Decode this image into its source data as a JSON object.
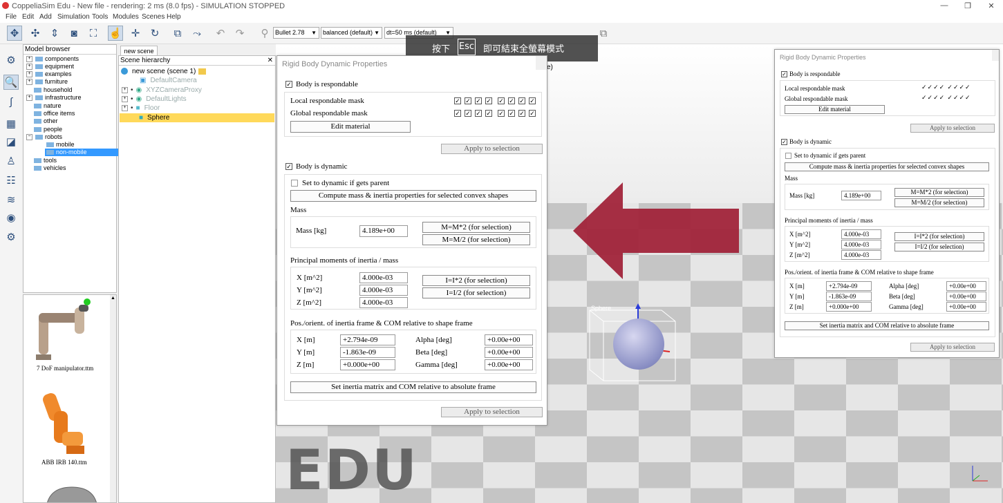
{
  "window": {
    "title": "CoppeliaSim Edu - New file - rendering: 2 ms (8.0 fps) - SIMULATION STOPPED"
  },
  "menu": [
    "File",
    "Edit",
    "Add",
    "Simulation",
    "Tools",
    "Modules",
    "Scenes",
    "Help"
  ],
  "toolbar": {
    "engine": "Bullet 2.78",
    "mode": "balanced (default)",
    "dt": "dt=50 ms (default)"
  },
  "model_browser": {
    "header": "Model browser",
    "items": [
      "components",
      "equipment",
      "examples",
      "furniture",
      "household",
      "infrastructure",
      "nature",
      "office items",
      "other",
      "people",
      "robots",
      "mobile",
      "non-mobile",
      "tools",
      "vehicles"
    ],
    "thumbnails": [
      "7 DoF manipulator.ttm",
      "ABB IRB 140.ttm"
    ]
  },
  "scene": {
    "tab": "new scene",
    "header": "Scene hierarchy",
    "root": "new scene (scene 1)",
    "objects": [
      "DefaultCamera",
      "XYZCameraProxy",
      "DefaultLights",
      "Floor",
      "Sphere"
    ]
  },
  "viewport": {
    "watermark": "EDU",
    "sphere_label": "Sphere",
    "partial_text": "e)"
  },
  "esc_banner": {
    "before": "按下",
    "key": "Esc",
    "after": "即可結束全螢幕模式"
  },
  "dialog": {
    "title": "Rigid Body Dynamic Properties",
    "body_respondable": "Body is respondable",
    "local_mask": "Local respondable mask",
    "global_mask": "Global respondable mask",
    "edit_material": "Edit material",
    "apply": "Apply to selection",
    "body_dynamic": "Body is dynamic",
    "set_dynamic_parent": "Set to dynamic if gets parent",
    "compute_mass": "Compute mass & inertia properties for selected convex shapes",
    "mass_section": "Mass",
    "mass_label": "Mass [kg]",
    "mass_value": "4.189e+00",
    "mass_x2": "M=M*2  (for selection)",
    "mass_div2": "M=M/2  (for selection)",
    "inertia_section": "Principal moments of inertia / mass",
    "ix_label": "X [m^2]",
    "iy_label": "Y [m^2]",
    "iz_label": "Z [m^2]",
    "ix": "4.000e-03",
    "iy": "4.000e-03",
    "iz": "4.000e-03",
    "inertia_x2": "I=I*2  (for selection)",
    "inertia_div2": "I=I/2  (for selection)",
    "pos_section": "Pos./orient. of inertia frame & COM relative to shape frame",
    "px_label": "X [m]",
    "py_label": "Y [m]",
    "pz_label": "Z [m]",
    "px": "+2.794e-09",
    "py": "-1.863e-09",
    "pz": "+0.000e+00",
    "alpha_label": "Alpha [deg]",
    "beta_label": "Beta [deg]",
    "gamma_label": "Gamma [deg]",
    "alpha": "+0.00e+00",
    "beta": "+0.00e+00",
    "gamma": "+0.00e+00",
    "set_absolute": "Set inertia matrix and COM relative to absolute frame"
  },
  "colors": {
    "arrow": "#a01e35",
    "selection": "#ffd95a",
    "folder": "#7fb3e0"
  }
}
